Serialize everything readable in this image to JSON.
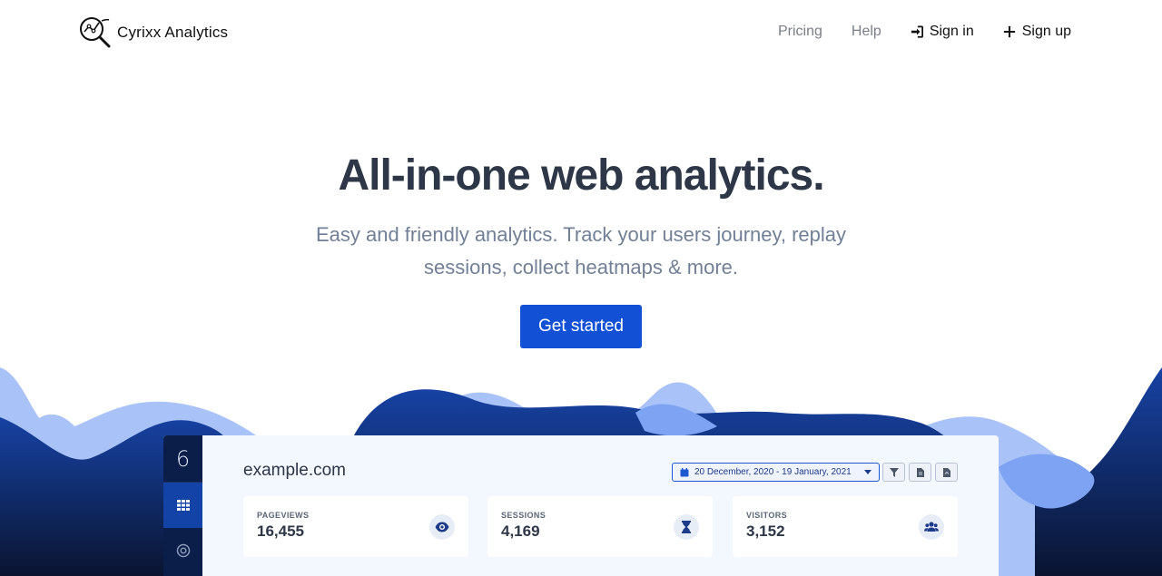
{
  "brand": {
    "name": "Cyrixx Analytics",
    "logo_icon": "magnifier-chart-icon"
  },
  "nav": {
    "pricing": "Pricing",
    "help": "Help",
    "signin": "Sign in",
    "signup": "Sign up"
  },
  "hero": {
    "title": "All-in-one web analytics.",
    "subtitle": "Easy and friendly analytics. Track your users journey, replay sessions, collect heatmaps & more.",
    "cta": "Get started"
  },
  "dashboard": {
    "sidebar_logo": "6",
    "site": "example.com",
    "date_range": "20 December, 2020 - 19 January, 2021",
    "stats": [
      {
        "label": "PAGEVIEWS",
        "value": "16,455",
        "icon": "eye-icon"
      },
      {
        "label": "SESSIONS",
        "value": "4,169",
        "icon": "hourglass-icon"
      },
      {
        "label": "VISITORS",
        "value": "3,152",
        "icon": "users-icon"
      }
    ]
  },
  "colors": {
    "accent": "#1250d6",
    "dark_navy": "#0a1e49",
    "wave_light": "#a9c3f8",
    "wave_mid": "#7ea3f2",
    "wave_dark": "#1742a3"
  }
}
